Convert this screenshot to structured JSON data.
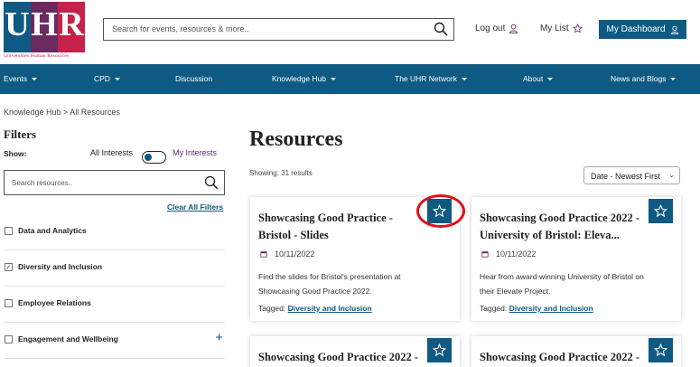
{
  "brand": {
    "logo_letters": [
      "U",
      "H",
      "R"
    ],
    "tagline": "Universities Human Resources",
    "colors": {
      "primary": "#0e5a82",
      "purple": "#6a2a5f",
      "crimson": "#c4224b"
    }
  },
  "header": {
    "search_placeholder": "Search for events, resources & more..",
    "logout_label": "Log out",
    "mylist_label": "My List",
    "dashboard_label": "My Dashboard"
  },
  "nav": {
    "items": [
      {
        "label": "Events",
        "dropdown": true
      },
      {
        "label": "CPD",
        "dropdown": true
      },
      {
        "label": "Discussion",
        "dropdown": false
      },
      {
        "label": "Knowledge Hub",
        "dropdown": true
      },
      {
        "label": "The UHR Network",
        "dropdown": true
      },
      {
        "label": "About",
        "dropdown": true
      },
      {
        "label": "News and Blogs",
        "dropdown": true
      }
    ]
  },
  "breadcrumb": "Knowledge Hub > All Resources",
  "filters": {
    "title": "Filters",
    "show_label": "Show:",
    "all_interests": "All Interests",
    "my_interests": "My Interests",
    "search_placeholder": "Search resources..",
    "clear_all": "Clear All Filters",
    "items": [
      {
        "label": "Data and Analytics",
        "checked": false,
        "expandable": false
      },
      {
        "label": "Diversity and Inclusion",
        "checked": true,
        "expandable": false
      },
      {
        "label": "Employee Relations",
        "checked": false,
        "expandable": false
      },
      {
        "label": "Engagement and Wellbeing",
        "checked": false,
        "expandable": true
      }
    ]
  },
  "main": {
    "title": "Resources",
    "showing": "Showing: 31 results",
    "sort_selected": "Date - Newest First",
    "cards": [
      {
        "title": "Showcasing Good Practice - Bristol - Slides",
        "date": "10/11/2022",
        "description": "Find the slides for Bristol's presentation at Showcasing Good Practice 2022.",
        "tagged_label": "Tagged:",
        "tag": "Diversity and Inclusion"
      },
      {
        "title": "Showcasing Good Practice 2022 - University of Bristol: Eleva...",
        "date": "10/11/2022",
        "description": "Hear from award-winning University of Bristol on their Elevate Project.",
        "tagged_label": "Tagged:",
        "tag": "Diversity and Inclusion"
      },
      {
        "title": "Showcasing Good Practice 2022 -"
      },
      {
        "title": "Showcasing Good Practice 2022 -"
      }
    ]
  }
}
